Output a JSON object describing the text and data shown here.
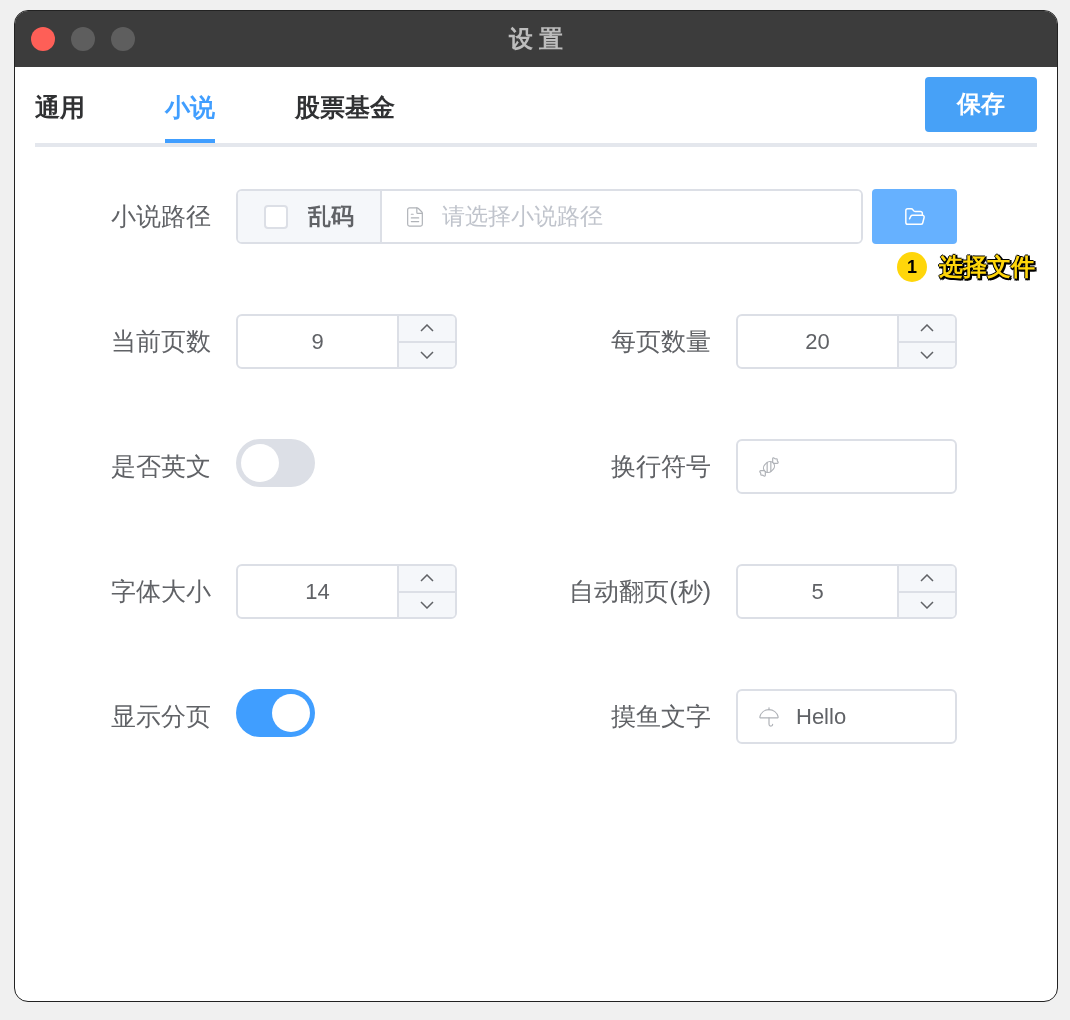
{
  "window": {
    "title": "设 置"
  },
  "tabs": [
    {
      "label": "通用",
      "selected": false
    },
    {
      "label": "小说",
      "selected": true
    },
    {
      "label": "股票基金",
      "selected": false
    }
  ],
  "save_button": {
    "label": "保存"
  },
  "form": {
    "novel_path": {
      "label": "小说路径",
      "checkbox": {
        "label": "乱码",
        "checked": false
      },
      "placeholder": "请选择小说路径",
      "annotation": {
        "number": "1",
        "text": "选择文件"
      }
    },
    "current_page": {
      "label": "当前页数",
      "value": "9"
    },
    "page_size": {
      "label": "每页数量",
      "value": "20"
    },
    "english": {
      "label": "是否英文",
      "on": false
    },
    "line_break": {
      "label": "换行符号"
    },
    "font_size": {
      "label": "字体大小",
      "value": "14"
    },
    "auto_turn": {
      "label": "自动翻页(秒)",
      "value": "5"
    },
    "show_page": {
      "label": "显示分页",
      "on": true
    },
    "slack_text": {
      "label": "摸鱼文字",
      "value": "Hello"
    }
  }
}
